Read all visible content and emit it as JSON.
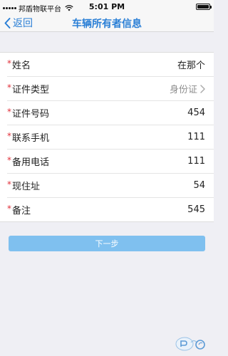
{
  "status_bar": {
    "carrier": "邦盾物联平台",
    "time": "5:01 PM",
    "battery_level": 1.0
  },
  "nav": {
    "back_label": "返回",
    "title": "车辆所有者信息"
  },
  "form": {
    "rows": [
      {
        "label": "姓名",
        "value": "在那个",
        "required": true
      },
      {
        "label": "证件类型",
        "value": "身份证",
        "required": true,
        "has_chevron": true
      },
      {
        "label": "证件号码",
        "value": "454",
        "required": true
      },
      {
        "label": "联系手机",
        "value": "111",
        "required": true
      },
      {
        "label": "备用电话",
        "value": "111",
        "required": true
      },
      {
        "label": "现住址",
        "value": "54",
        "required": true
      },
      {
        "label": "备注",
        "value": "545",
        "required": true
      }
    ],
    "required_mark": "*"
  },
  "next_button": {
    "label": "下一步"
  },
  "colors": {
    "accent": "#2a7fd6",
    "button": "#7fc0ef",
    "required": "#e0303a",
    "background": "#efeff4"
  },
  "icons": {
    "back": "chevron-left-icon",
    "select": "chevron-right-icon",
    "wifi": "wifi-icon",
    "battery": "battery-icon",
    "signal": "signal-icon",
    "watermark": "watermark-logo"
  }
}
